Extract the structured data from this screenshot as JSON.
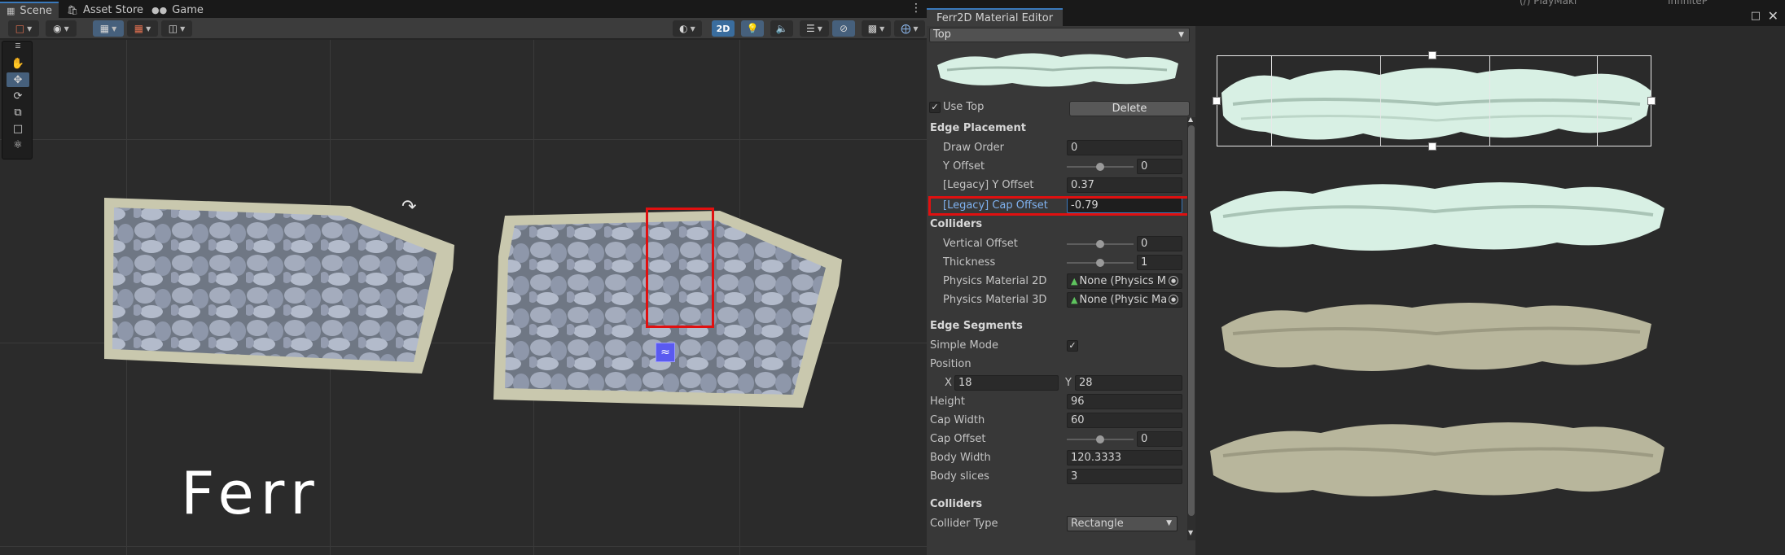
{
  "scene_window": {
    "tabs": [
      {
        "label": "Scene",
        "icon": "grid-icon",
        "active": true
      },
      {
        "label": "Asset Store",
        "icon": "bag-icon",
        "active": false
      },
      {
        "label": "Game",
        "icon": "gamepad-icon",
        "active": false
      }
    ],
    "toolbar": {
      "mode_2d_label": "2D"
    },
    "scene_text": "Ferr"
  },
  "material_editor": {
    "title": "Ferr2D Material Editor",
    "background_labels": {
      "playmaker": "(/) PlayMaki",
      "infinite": "InfiniteP"
    },
    "edge_selector": "Top",
    "use_top_label": "Use Top",
    "use_top_checked": true,
    "delete_label": "Delete",
    "edge_placement": {
      "heading": "Edge Placement",
      "draw_order_label": "Draw Order",
      "draw_order_value": "0",
      "y_offset_label": "Y Offset",
      "y_offset_value": "0",
      "legacy_y_offset_label": "[Legacy] Y Offset",
      "legacy_y_offset_value": "0.37",
      "legacy_cap_offset_label": "[Legacy] Cap Offset",
      "legacy_cap_offset_value": "-0.79"
    },
    "colliders": {
      "heading": "Colliders",
      "vertical_offset_label": "Vertical Offset",
      "vertical_offset_value": "0",
      "thickness_label": "Thickness",
      "thickness_value": "1",
      "physics_2d_label": "Physics Material 2D",
      "physics_2d_value": "None (Physics M",
      "physics_3d_label": "Physics Material 3D",
      "physics_3d_value": "None (Physic Ma"
    },
    "edge_segments": {
      "heading": "Edge Segments",
      "simple_mode_label": "Simple Mode",
      "simple_mode_checked": true,
      "position_label": "Position",
      "x_label": "X",
      "x_value": "18",
      "y_label": "Y",
      "y_value": "28",
      "height_label": "Height",
      "height_value": "96",
      "cap_width_label": "Cap Width",
      "cap_width_value": "60",
      "cap_offset_label": "Cap Offset",
      "cap_offset_value": "0",
      "body_width_label": "Body Width",
      "body_width_value": "120.3333",
      "body_slices_label": "Body slices",
      "body_slices_value": "3"
    },
    "segment_colliders": {
      "heading": "Colliders",
      "collider_type_label": "Collider Type",
      "collider_type_value": "Rectangle"
    }
  },
  "colors": {
    "accent": "#3a79bb",
    "highlight_red": "#e01010",
    "edge_light": "#d8f0e4",
    "edge_dark": "#b8b69c"
  }
}
